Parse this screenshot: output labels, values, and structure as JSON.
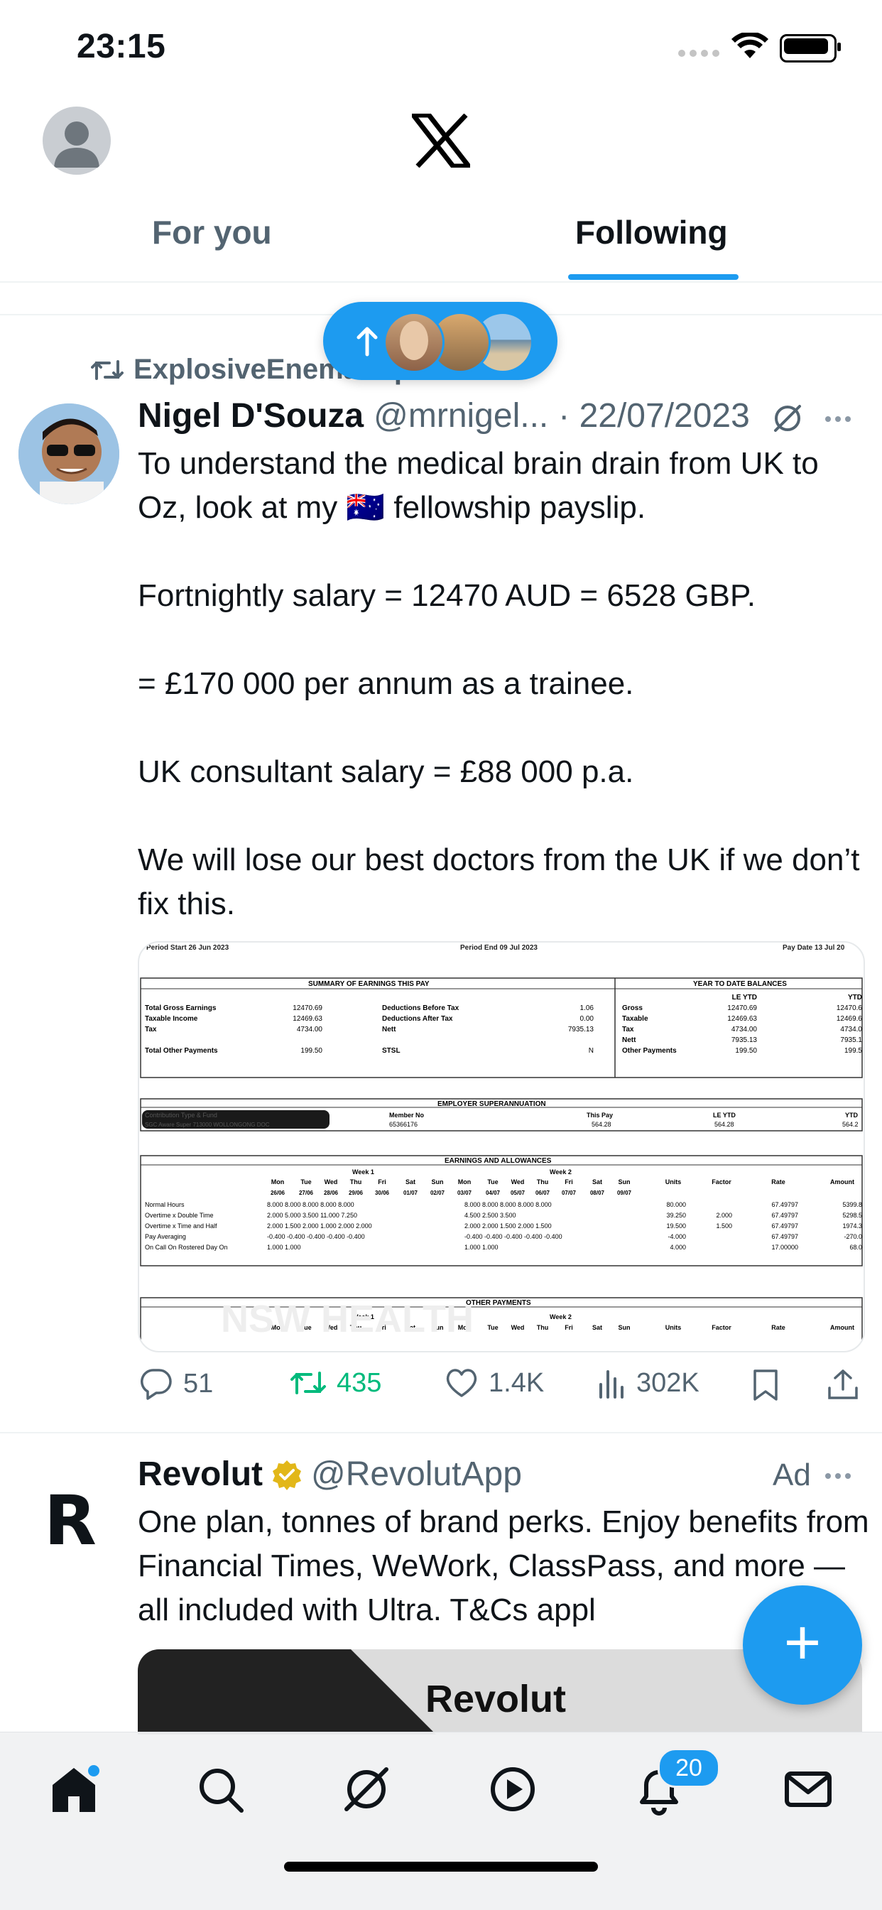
{
  "status_bar": {
    "time": "23:15"
  },
  "header": {
    "tabs": [
      {
        "label": "For you"
      },
      {
        "label": "Following"
      }
    ],
    "active_tab": "Following"
  },
  "new_posts_pill": {
    "arrow": "arrow-up-icon"
  },
  "tweet": {
    "repost_label": "ExplosiveEnema reposted",
    "author_name": "Nigel D'Souza",
    "handle": "@mrnigel...",
    "date": "· 22/07/2023",
    "body": "To understand the medical brain drain from UK to Oz, look at my 🇦🇺 fellowship payslip.\n\nFortnightly salary = 12470 AUD = 6528 GBP.\n\n= £170 000 per annum as a trainee.\n\nUK consultant salary = £88 000 p.a.\n\nWe will lose our best doctors from the UK if we don’t fix this.",
    "payslip": {
      "period_start": "Period Start  26 Jun 2023",
      "period_end": "Period End  09 Jul 2023",
      "pay_date": "Pay Date  13 Jul 20",
      "summary_title": "SUMMARY OF EARNINGS THIS PAY",
      "ytd_title": "YEAR TO DATE BALANCES",
      "summary_rows": [
        [
          "Total Gross Earnings",
          "12470.69",
          "Deductions Before Tax",
          "1.06"
        ],
        [
          "Taxable Income",
          "12469.63",
          "Deductions After Tax",
          "0.00"
        ],
        [
          "Tax",
          "4734.00",
          "Nett",
          "7935.13"
        ],
        [
          "Total Other Payments",
          "199.50",
          "STSL",
          "N"
        ]
      ],
      "ytd_headers": [
        "LE YTD",
        "YTD"
      ],
      "ytd_rows": [
        [
          "Gross",
          "12470.69",
          "12470.6"
        ],
        [
          "Taxable",
          "12469.63",
          "12469.6"
        ],
        [
          "Tax",
          "4734.00",
          "4734.0"
        ],
        [
          "Nett",
          "7935.13",
          "7935.1"
        ],
        [
          "Other Payments",
          "199.50",
          "199.5"
        ]
      ],
      "super_title": "EMPLOYER SUPERANNUATION",
      "super_headers": [
        "Contribution Type & Fund",
        "Member No",
        "This Pay",
        "LE YTD",
        "YTD"
      ],
      "super_row": [
        "SGC Aware Super 713000 WOLLONGONG DOC",
        "65366176",
        "564.28",
        "564.28",
        "564.2"
      ],
      "earnings_title": "EARNINGS AND ALLOWANCES",
      "week1": "Week 1",
      "week2": "Week 2",
      "day_headers": [
        "Mon",
        "Tue",
        "Wed",
        "Thu",
        "Fri",
        "Sat",
        "Sun",
        "Mon",
        "Tue",
        "Wed",
        "Thu",
        "Fri",
        "Sat",
        "Sun",
        "Units",
        "Factor",
        "Rate",
        "Amount"
      ],
      "date_headers": [
        "26/06",
        "27/06",
        "28/06",
        "29/06",
        "30/06",
        "01/07",
        "02/07",
        "03/07",
        "04/07",
        "05/07",
        "06/07",
        "07/07",
        "08/07",
        "09/07"
      ],
      "earning_rows": [
        [
          "Normal Hours",
          "8.000 8.000 8.000 8.000 8.000",
          "8.000 8.000 8.000 8.000 8.000",
          "80.000",
          "",
          "67.49797",
          "5399.8"
        ],
        [
          "Overtime x Double Time",
          "2.000  5.000  3.500 11.000 7.250",
          "4.500 2.500  3.500",
          "39.250",
          "2.000",
          "67.49797",
          "5298.5"
        ],
        [
          "Overtime x Time and Half",
          "2.000 1.500 2.000 1.000 2.000 2.000",
          "2.000 2.000 1.500 2.000 1.500",
          "19.500",
          "1.500",
          "67.49797",
          "1974.3"
        ],
        [
          "Pay Averaging",
          "-0.400 -0.400 -0.400 -0.400 -0.400",
          "-0.400 -0.400 -0.400 -0.400 -0.400",
          "-4.000",
          "",
          "67.49797",
          "-270.0"
        ],
        [
          "On Call On Rostered Day On",
          "1.000  1.000",
          "1.000  1.000",
          "4.000",
          "",
          "17.00000",
          "68.0"
        ]
      ],
      "other_title": "OTHER PAYMENTS",
      "watermark": "NSW HEALTH"
    },
    "actions": {
      "replies": "51",
      "reposts": "435",
      "likes": "1.4K",
      "views": "302K"
    }
  },
  "ad": {
    "brand": "Revolut",
    "handle": "@RevolutApp",
    "tag": "Ad",
    "body": "One plan, tonnes of brand perks. Enjoy benefits from Financial Times, WeWork, ClassPass, and more — all included with Ultra. T&Cs appl",
    "banner_text": "Revolut"
  },
  "fab": {
    "label": "+"
  },
  "bottom_nav": {
    "items": [
      "home-icon",
      "search-icon",
      "grok-icon",
      "video-icon",
      "notifications-icon",
      "messages-icon"
    ],
    "notification_badge": "20"
  },
  "colors": {
    "accent": "#1d9bf0",
    "repost_green": "#00ba7c",
    "text_secondary": "#536471"
  }
}
